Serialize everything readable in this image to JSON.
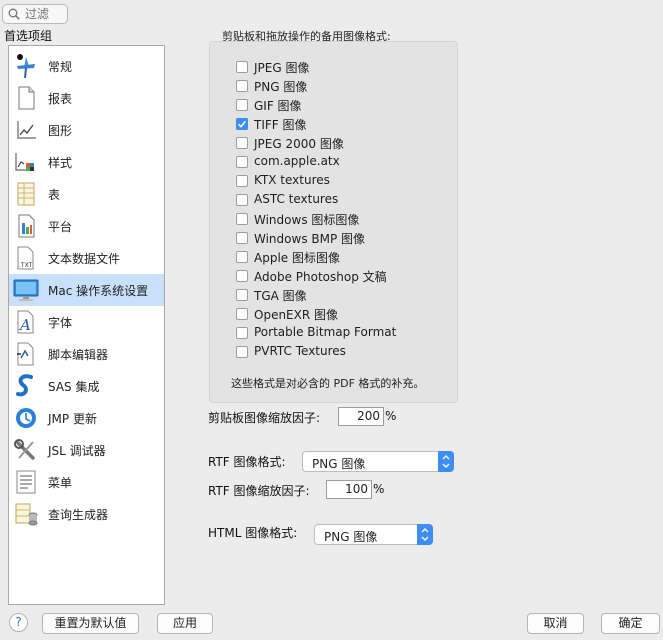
{
  "search": {
    "placeholder": "过滤"
  },
  "sidebar": {
    "title": "首选项组",
    "items": [
      {
        "label": "常规",
        "icon": "pushpin-icon"
      },
      {
        "label": "报表",
        "icon": "report-page-icon"
      },
      {
        "label": "图形",
        "icon": "graph-icon"
      },
      {
        "label": "样式",
        "icon": "style-icon"
      },
      {
        "label": "表",
        "icon": "table-icon"
      },
      {
        "label": "平台",
        "icon": "platform-icon"
      },
      {
        "label": "文本数据文件",
        "icon": "txt-file-icon"
      },
      {
        "label": "Mac 操作系统设置",
        "icon": "monitor-icon",
        "selected": true
      },
      {
        "label": "字体",
        "icon": "font-icon"
      },
      {
        "label": "脚本编辑器",
        "icon": "script-editor-icon"
      },
      {
        "label": "SAS 集成",
        "icon": "sas-icon"
      },
      {
        "label": "JMP 更新",
        "icon": "jmp-update-icon"
      },
      {
        "label": "JSL 调试器",
        "icon": "wrench-icon"
      },
      {
        "label": "菜单",
        "icon": "menu-icon"
      },
      {
        "label": "查询生成器",
        "icon": "query-builder-icon"
      }
    ]
  },
  "formats": {
    "title": "剪贴板和拖放操作的备用图像格式:",
    "items": [
      {
        "label": "JPEG 图像",
        "checked": false
      },
      {
        "label": "PNG 图像",
        "checked": false
      },
      {
        "label": "GIF 图像",
        "checked": false
      },
      {
        "label": "TIFF 图像",
        "checked": true
      },
      {
        "label": "JPEG 2000 图像",
        "checked": false
      },
      {
        "label": "com.apple.atx",
        "checked": false
      },
      {
        "label": "KTX textures",
        "checked": false
      },
      {
        "label": "ASTC textures",
        "checked": false
      },
      {
        "label": "Windows 图标图像",
        "checked": false
      },
      {
        "label": "Windows BMP 图像",
        "checked": false
      },
      {
        "label": "Apple 图标图像",
        "checked": false
      },
      {
        "label": "Adobe Photoshop 文稿",
        "checked": false
      },
      {
        "label": "TGA 图像",
        "checked": false
      },
      {
        "label": "OpenEXR 图像",
        "checked": false
      },
      {
        "label": "Portable Bitmap Format",
        "checked": false
      },
      {
        "label": "PVRTC Textures",
        "checked": false
      }
    ],
    "note": "这些格式是对必含的 PDF 格式的补充。"
  },
  "clipboard_scale": {
    "label": "剪贴板图像缩放因子:",
    "value": "200",
    "unit": "%"
  },
  "rtf_format": {
    "label": "RTF 图像格式:",
    "value": "PNG 图像"
  },
  "rtf_scale": {
    "label": "RTF 图像缩放因子:",
    "value": "100",
    "unit": "%"
  },
  "html_format": {
    "label": "HTML 图像格式:",
    "value": "PNG 图像"
  },
  "buttons": {
    "help": "?",
    "reset": "重置为默认值",
    "apply": "应用",
    "cancel": "取消",
    "ok": "确定"
  },
  "colors": {
    "selection": "#c9e0fb",
    "accent": "#3d8df5",
    "panel": "#e3e3e3"
  }
}
